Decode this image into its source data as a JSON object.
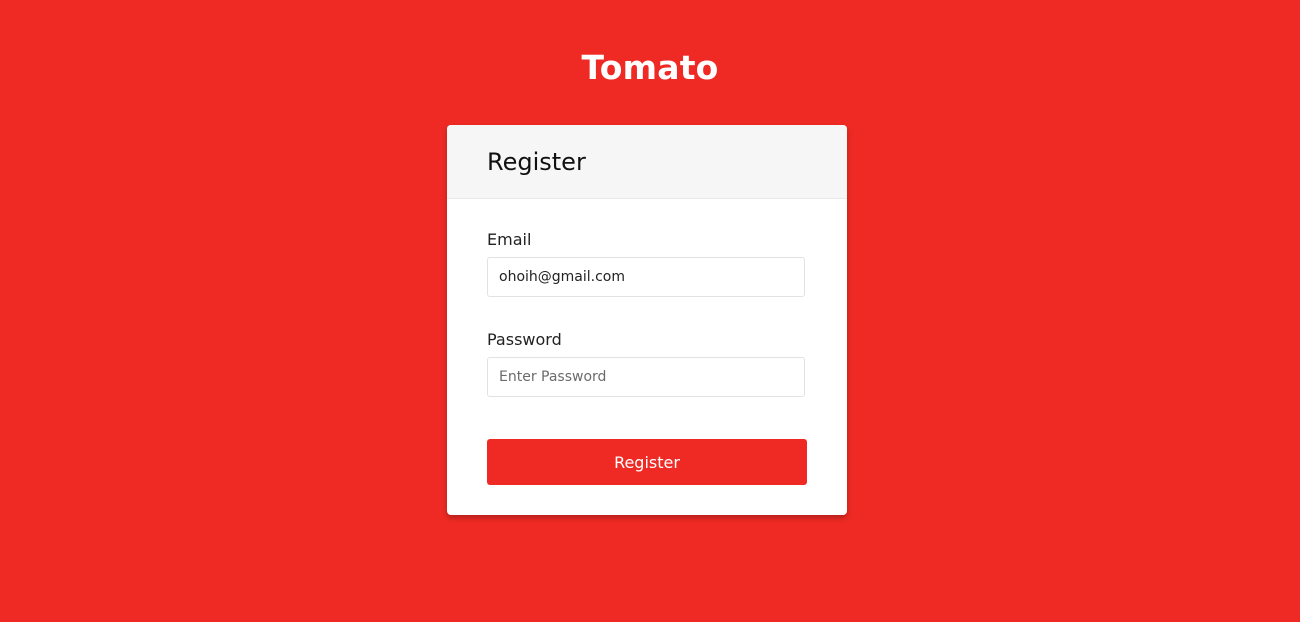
{
  "app": {
    "brand": "Tomato"
  },
  "form": {
    "title": "Register",
    "email": {
      "label": "Email",
      "value": "ohoih@gmail.com",
      "placeholder": ""
    },
    "password": {
      "label": "Password",
      "value": "",
      "placeholder": "Enter Password"
    },
    "submit_label": "Register"
  },
  "colors": {
    "background": "#ef2a24",
    "card": "#ffffff",
    "card_header": "#f6f6f6",
    "button": "#ef2a24"
  }
}
